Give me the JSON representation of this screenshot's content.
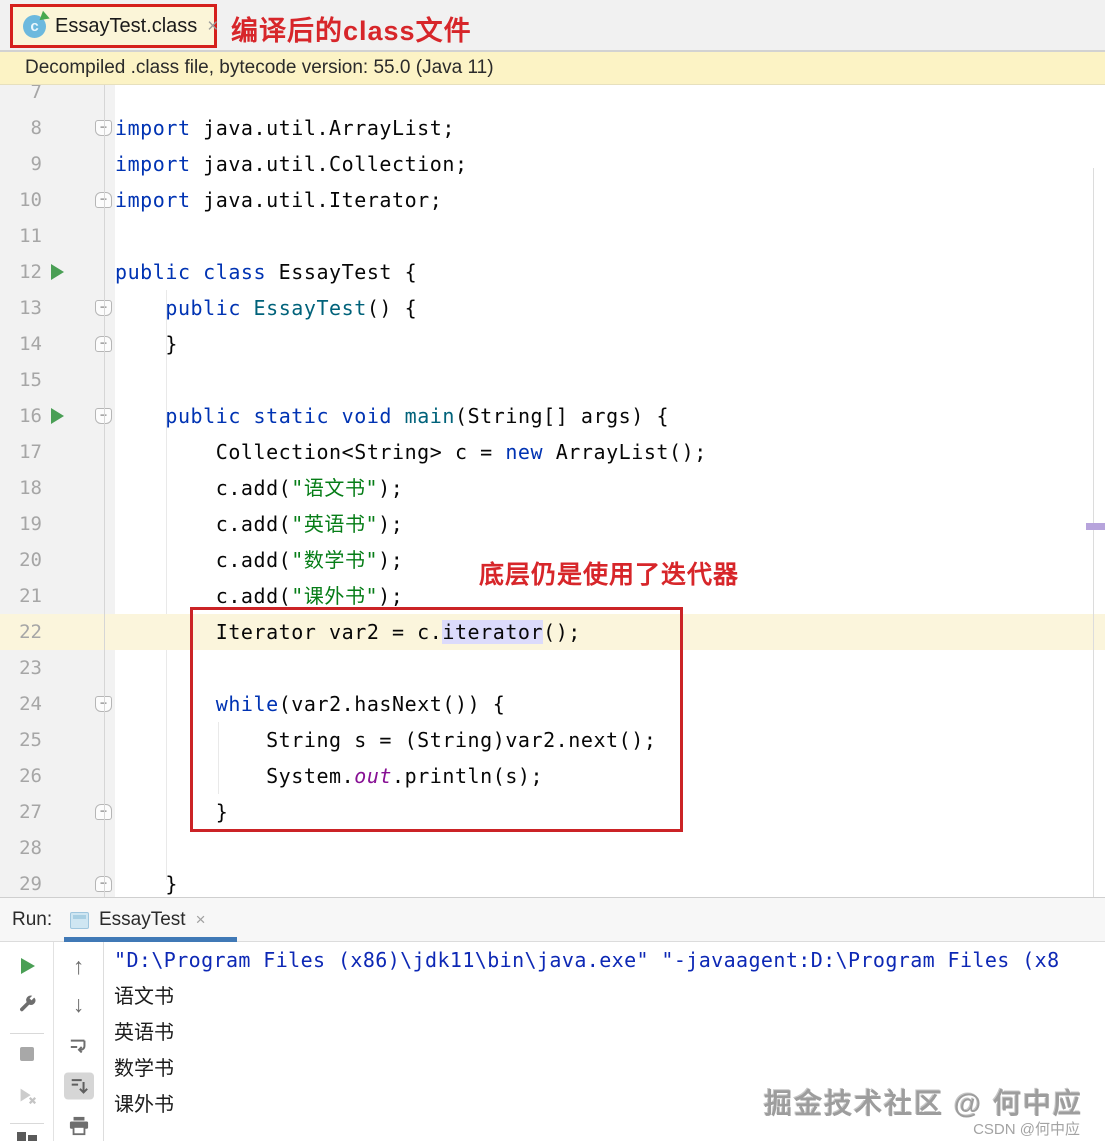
{
  "colors": {
    "keyword": "#0033b3",
    "string": "#067d17",
    "method_decl": "#00627a",
    "field": "#871094",
    "annotation_red": "#d7262a",
    "red_box_border": "#cb2326",
    "console_command_blue": "#0d28b5",
    "current_line_bg": "#fbf5dc",
    "usage_highlight_bg": "#dcdbfb",
    "run_tab_underline": "#4079b6",
    "run_gutter_green": "#4a9f55"
  },
  "tab_bar": {
    "tab_label": "EssayTest.class",
    "close_glyph": "×",
    "icon_letter": "c",
    "annotation": "编译后的class文件"
  },
  "banner": {
    "text": "Decompiled .class file, bytecode version: 55.0 (Java 11)"
  },
  "editor": {
    "annotation": "底层仍是使用了迭代器",
    "fold_minus": "−",
    "lines": [
      {
        "num": "7",
        "segments": []
      },
      {
        "num": "8",
        "fold": "open",
        "segments": [
          {
            "c": "kw",
            "t": "import"
          },
          {
            "c": "pl",
            "t": " java.util.ArrayList;"
          }
        ]
      },
      {
        "num": "9",
        "segments": [
          {
            "c": "kw",
            "t": "import"
          },
          {
            "c": "pl",
            "t": " java.util.Collection;"
          }
        ]
      },
      {
        "num": "10",
        "fold": "close",
        "segments": [
          {
            "c": "kw",
            "t": "import"
          },
          {
            "c": "pl",
            "t": " java.util.Iterator;"
          }
        ]
      },
      {
        "num": "11",
        "segments": []
      },
      {
        "num": "12",
        "run": true,
        "segments": [
          {
            "c": "kw",
            "t": "public class"
          },
          {
            "c": "pl",
            "t": " EssayTest {"
          }
        ]
      },
      {
        "num": "13",
        "fold": "open",
        "segments": [
          {
            "c": "pl",
            "t": "    "
          },
          {
            "c": "kw",
            "t": "public"
          },
          {
            "c": "pl",
            "t": " "
          },
          {
            "c": "me",
            "t": "EssayTest"
          },
          {
            "c": "pl",
            "t": "() {"
          }
        ]
      },
      {
        "num": "14",
        "fold": "close",
        "segments": [
          {
            "c": "pl",
            "t": "    }"
          }
        ]
      },
      {
        "num": "15",
        "segments": []
      },
      {
        "num": "16",
        "run": true,
        "fold": "open",
        "segments": [
          {
            "c": "pl",
            "t": "    "
          },
          {
            "c": "kw",
            "t": "public static void"
          },
          {
            "c": "pl",
            "t": " "
          },
          {
            "c": "me",
            "t": "main"
          },
          {
            "c": "pl",
            "t": "(String[] args) {"
          }
        ]
      },
      {
        "num": "17",
        "segments": [
          {
            "c": "pl",
            "t": "        Collection<String> c = "
          },
          {
            "c": "kw",
            "t": "new"
          },
          {
            "c": "pl",
            "t": " ArrayList();"
          }
        ]
      },
      {
        "num": "18",
        "segments": [
          {
            "c": "pl",
            "t": "        c.add("
          },
          {
            "c": "st",
            "t": "\"语文书\""
          },
          {
            "c": "pl",
            "t": ");"
          }
        ]
      },
      {
        "num": "19",
        "segments": [
          {
            "c": "pl",
            "t": "        c.add("
          },
          {
            "c": "st",
            "t": "\"英语书\""
          },
          {
            "c": "pl",
            "t": ");"
          }
        ]
      },
      {
        "num": "20",
        "segments": [
          {
            "c": "pl",
            "t": "        c.add("
          },
          {
            "c": "st",
            "t": "\"数学书\""
          },
          {
            "c": "pl",
            "t": ");"
          }
        ]
      },
      {
        "num": "21",
        "segments": [
          {
            "c": "pl",
            "t": "        c.add("
          },
          {
            "c": "st",
            "t": "\"课外书\""
          },
          {
            "c": "pl",
            "t": ");"
          }
        ]
      },
      {
        "num": "22",
        "current": true,
        "segments": [
          {
            "c": "pl",
            "t": "        Iterator var2 = c."
          },
          {
            "c": "hl",
            "t": "iterator"
          },
          {
            "c": "pl",
            "t": "();"
          }
        ]
      },
      {
        "num": "23",
        "segments": []
      },
      {
        "num": "24",
        "fold": "open",
        "segments": [
          {
            "c": "pl",
            "t": "        "
          },
          {
            "c": "kw",
            "t": "while"
          },
          {
            "c": "pl",
            "t": "(var2.hasNext()) {"
          }
        ]
      },
      {
        "num": "25",
        "segments": [
          {
            "c": "pl",
            "t": "            String s = (String)var2.next();"
          }
        ]
      },
      {
        "num": "26",
        "segments": [
          {
            "c": "pl",
            "t": "            System."
          },
          {
            "c": "fi",
            "t": "out"
          },
          {
            "c": "pl",
            "t": ".println(s);"
          }
        ]
      },
      {
        "num": "27",
        "fold": "close",
        "segments": [
          {
            "c": "pl",
            "t": "        }"
          }
        ]
      },
      {
        "num": "28",
        "segments": []
      },
      {
        "num": "29",
        "fold": "close",
        "segments": [
          {
            "c": "pl",
            "t": "    }"
          }
        ]
      }
    ]
  },
  "run_panel": {
    "label": "Run:",
    "tab_label": "EssayTest",
    "close_glyph": "×",
    "up_glyph": "↑",
    "down_glyph": "↓",
    "toolbar_icons": [
      "rerun-icon",
      "settings-wrench-icon",
      "stop-icon",
      "rerun-failed-tests-icon",
      "layout-icon",
      "up-arrow-icon",
      "down-arrow-icon",
      "soft-wrap-icon",
      "scroll-to-end-icon",
      "print-icon"
    ],
    "console_lines": [
      {
        "kind": "cmd",
        "text": "\"D:\\Program Files (x86)\\jdk11\\bin\\java.exe\" \"-javaagent:D:\\Program Files (x8"
      },
      {
        "kind": "out",
        "text": "语文书"
      },
      {
        "kind": "out",
        "text": "英语书"
      },
      {
        "kind": "out",
        "text": "数学书"
      },
      {
        "kind": "out",
        "text": "课外书"
      }
    ]
  },
  "watermark": {
    "primary": "掘金技术社区 @ 何中应",
    "secondary": "CSDN @何中应"
  }
}
